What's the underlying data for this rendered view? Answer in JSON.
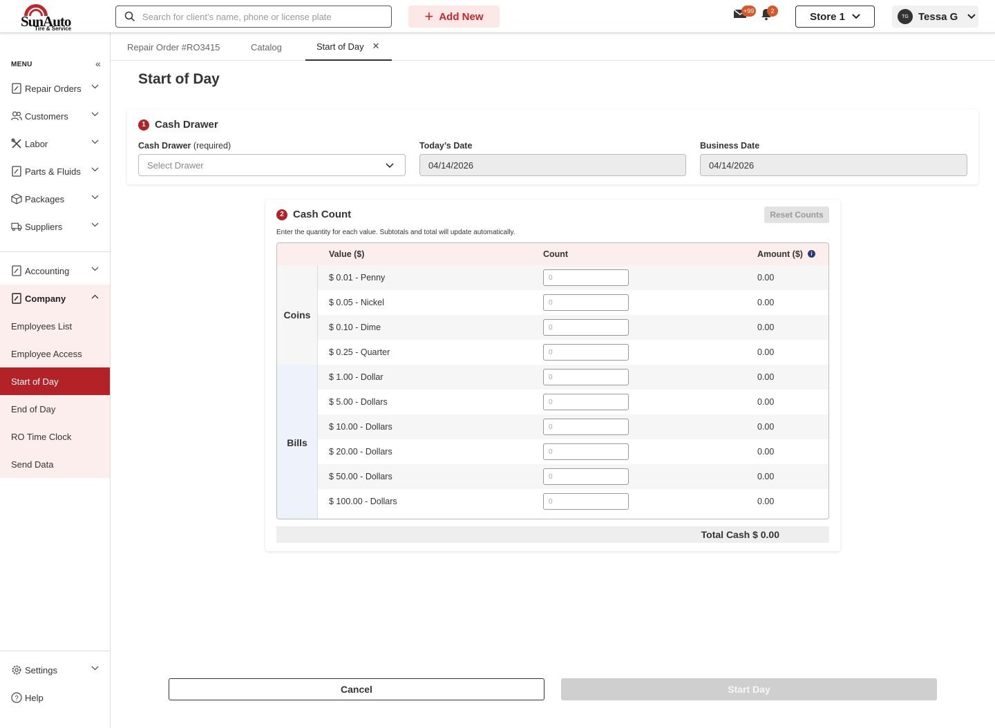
{
  "header": {
    "logo_brand": "SunAuto",
    "logo_sub": "Tire & Service",
    "search_placeholder": "Search for client’s name, phone or license plate",
    "add_new": "Add New",
    "mail_badge": "+99",
    "bell_badge": "2",
    "store": "Store 1",
    "user_initials": "TG",
    "user_name": "Tessa G"
  },
  "sidebar": {
    "menu_label": "MENU",
    "items": [
      {
        "label": "Repair Orders",
        "icon": "clipboard-icon"
      },
      {
        "label": "Customers",
        "icon": "users-icon"
      },
      {
        "label": "Labor",
        "icon": "tools-icon"
      },
      {
        "label": "Parts & Fluids",
        "icon": "clipboard-icon"
      },
      {
        "label": "Packages",
        "icon": "box-icon"
      },
      {
        "label": "Suppliers",
        "icon": "truck-icon"
      }
    ],
    "accounting": "Accounting",
    "company": "Company",
    "company_sub": [
      "Employees List",
      "Employee Access",
      "Start of Day",
      "End of Day",
      "RO Time Clock",
      "Send Data"
    ],
    "settings": "Settings",
    "help": "Help"
  },
  "tabs": [
    {
      "label": "Repair Order #RO3415"
    },
    {
      "label": "Catalog"
    },
    {
      "label": "Start of Day",
      "active": true
    }
  ],
  "page_title": "Start of Day",
  "cash_drawer": {
    "step": "1",
    "title": "Cash Drawer",
    "drawer_label": "Cash Drawer",
    "drawer_required": "(required)",
    "drawer_placeholder": "Select Drawer",
    "today_label": "Today’s Date",
    "today_value": "04/14/2026",
    "business_label": "Business Date",
    "business_value": "04/14/2026"
  },
  "cash_count": {
    "step": "2",
    "title": "Cash Count",
    "reset": "Reset Counts",
    "hint": "Enter the quantity for each value. Subtotals and total will update automatically.",
    "col_value": "Value ($)",
    "col_count": "Count",
    "col_amount": "Amount ($)",
    "coins_label": "Coins",
    "bills_label": "Bills",
    "rows": [
      {
        "value": "$ 0.01 - Penny",
        "count_placeholder": "0",
        "amount": "0.00"
      },
      {
        "value": "$ 0.05 - Nickel",
        "count_placeholder": "0",
        "amount": "0.00"
      },
      {
        "value": "$ 0.10 - Dime",
        "count_placeholder": "0",
        "amount": "0.00"
      },
      {
        "value": "$ 0.25 - Quarter",
        "count_placeholder": "0",
        "amount": "0.00"
      },
      {
        "value": "$ 1.00 - Dollar",
        "count_placeholder": "0",
        "amount": "0.00"
      },
      {
        "value": "$ 5.00 - Dollars",
        "count_placeholder": "0",
        "amount": "0.00"
      },
      {
        "value": "$ 10.00 - Dollars",
        "count_placeholder": "0",
        "amount": "0.00"
      },
      {
        "value": "$ 20.00 - Dollars",
        "count_placeholder": "0",
        "amount": "0.00"
      },
      {
        "value": "$ 50.00 - Dollars",
        "count_placeholder": "0",
        "amount": "0.00"
      },
      {
        "value": "$ 100.00 - Dollars",
        "count_placeholder": "0",
        "amount": "0.00"
      }
    ],
    "total": "Total Cash $ 0.00"
  },
  "footer": {
    "cancel": "Cancel",
    "start": "Start Day"
  },
  "colors": {
    "accent": "#b32226",
    "pink": "#fdeeee",
    "badge": "#d4582a",
    "bills_bg": "#eef2fb"
  }
}
